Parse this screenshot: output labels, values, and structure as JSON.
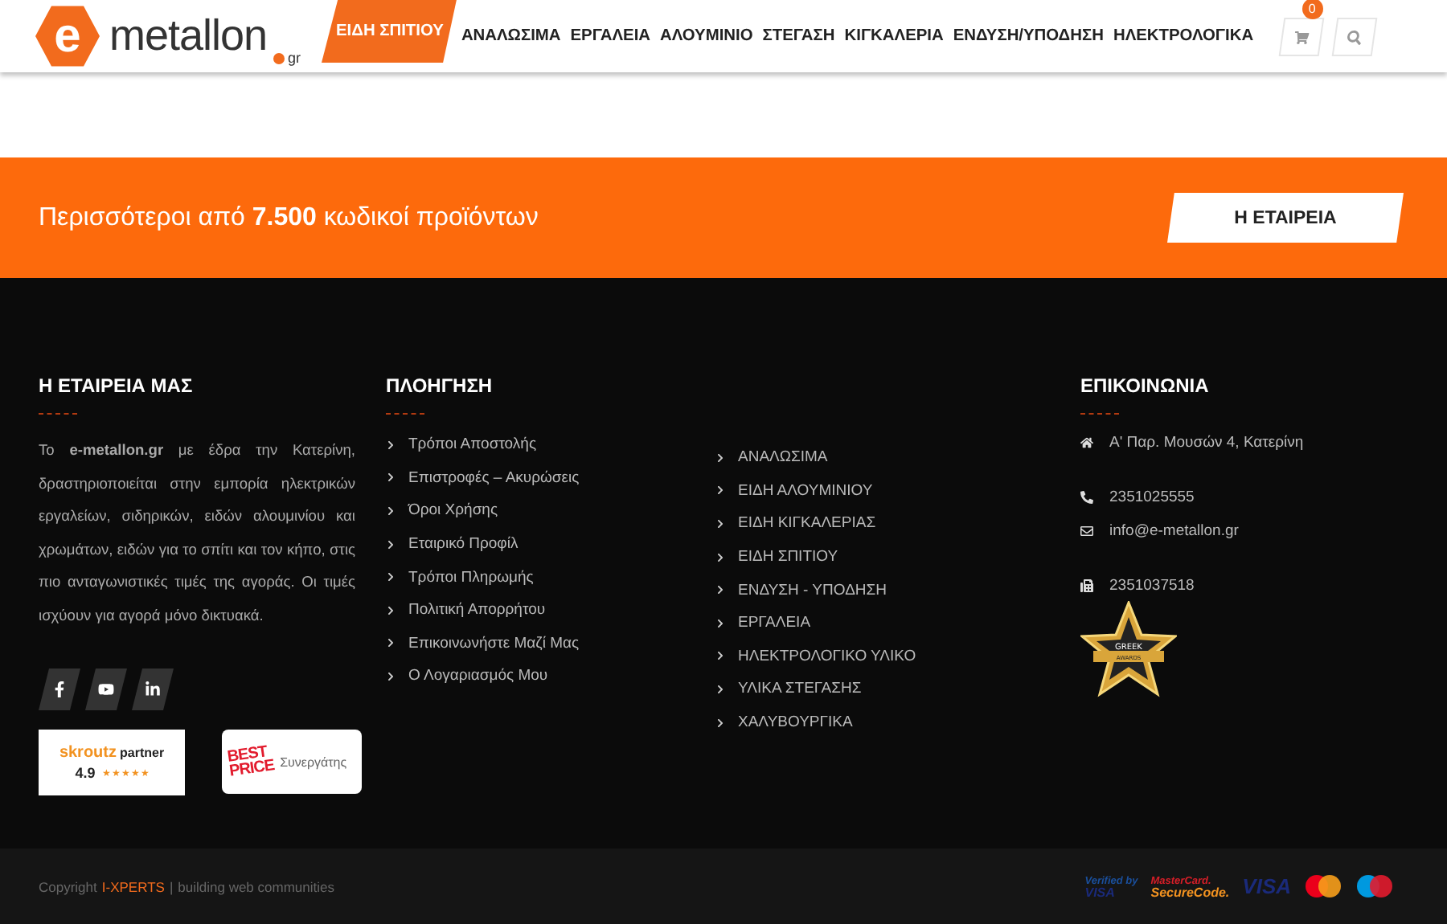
{
  "header": {
    "logo": {
      "letter": "e",
      "name": "metallon",
      "tld": "gr"
    },
    "nav": [
      {
        "label": "ΕΙΔΗ ΣΠΙΤΙΟΥ",
        "selected": true
      },
      {
        "label": "ΑΝΑΛΩΣΙΜΑ",
        "selected": false
      },
      {
        "label": "ΕΡΓΑΛΕΙΑ",
        "selected": false
      },
      {
        "label": "ΑΛΟΥΜΙΝΙΟ",
        "selected": false
      },
      {
        "label": "ΣΤΕΓΑΣΗ",
        "selected": false
      },
      {
        "label": "ΚΙΓΚΑΛΕΡΙΑ",
        "selected": false
      },
      {
        "label": "ΕΝΔΥΣΗ/ΥΠΟΔΗΣΗ",
        "selected": false
      },
      {
        "label": "ΗΛΕΚΤΡΟΛΟΓΙΚΑ",
        "selected": false
      }
    ],
    "cart_count": "0"
  },
  "banner": {
    "text": "Περισσότεροι από **7.500** κωδικοί προϊόντων",
    "button": "Η ΕΤΑΙΡΕΙΑ"
  },
  "footer": {
    "about": {
      "title": "Η ΕΤΑΙΡΕΙΑ ΜΑΣ",
      "text": "Το **e-metallon.gr** με έδρα την Κατερίνη, δραστηριοποιείται στην εμπορία ηλεκτρικών εργαλείων, σιδηρικών, ειδών αλουμινίου και χρωμάτων, ειδών για το σπίτι και τον κήπο, στις πιο ανταγωνιστικές τιμές της αγοράς. Οι τιμές ισχύουν για αγορά μόνο δικτυακά.",
      "social": [
        {
          "kind": "facebook"
        },
        {
          "kind": "youtube"
        },
        {
          "kind": "linkedin"
        }
      ],
      "skroutz": {
        "brand": "skroutz",
        "label": "partner",
        "rating": "4.9",
        "stars": 5
      },
      "bestprice": {
        "logo_top": "BEST",
        "logo_bottom": "PRICE",
        "label": "Συνεργάτης"
      }
    },
    "navigation": {
      "title": "ΠΛΟΗΓΗΣΗ",
      "links": [
        "Τρόποι Αποστολής",
        "Επιστροφές – Ακυρώσεις",
        "Όροι Χρήσης",
        "Εταιρικό Προφίλ",
        "Τρόποι Πληρωμής",
        "Πολιτική Απορρήτου",
        "Επικοινωνήστε Μαζί Μας",
        "Ο Λογαριασμός Μου"
      ],
      "categories": [
        "ΑΝΑΛΩΣΙΜΑ",
        "ΕΙΔΗ ΑΛΟΥΜΙΝΙΟΥ",
        "ΕΙΔΗ ΚΙΓΚΑΛΕΡΙΑΣ",
        "ΕΙΔΗ ΣΠΙΤΙΟΥ",
        "ΕΝΔΥΣΗ - ΥΠΟΔΗΣΗ",
        "ΕΡΓΑΛΕΙΑ",
        "ΗΛΕΚΤΡΟΛΟΓΙΚΟ ΥΛΙΚΟ",
        "ΥΛΙΚΑ ΣΤΕΓΑΣΗΣ",
        "ΧΑΛΥΒΟΥΡΓΙΚΑ"
      ]
    },
    "contact": {
      "title": "ΕΠΙΚΟΙΝΩΝΙΑ",
      "items": [
        {
          "kind": "address",
          "text": "Α' Παρ. Μουσών 4, Κατερίνη"
        },
        {
          "kind": "phone",
          "text": "2351025555"
        },
        {
          "kind": "email",
          "text": "info@e-metallon.gr"
        },
        {
          "kind": "fax",
          "text": "2351037518"
        }
      ],
      "award": {
        "top": "GREEK",
        "bottom": "AWARDS"
      }
    }
  },
  "bottom_bar": {
    "prefix": "Copyright",
    "brand": "I-XPERTS",
    "separator": "|",
    "suffix": "building web communities",
    "payments": [
      {
        "kind": "verified-visa",
        "top": "Verified by",
        "bottom": "VISA"
      },
      {
        "kind": "securecode",
        "top": "MasterCard.",
        "bottom": "SecureCode."
      },
      {
        "kind": "visa",
        "top": "VISA"
      },
      {
        "kind": "mastercard"
      },
      {
        "kind": "maestro"
      }
    ]
  }
}
